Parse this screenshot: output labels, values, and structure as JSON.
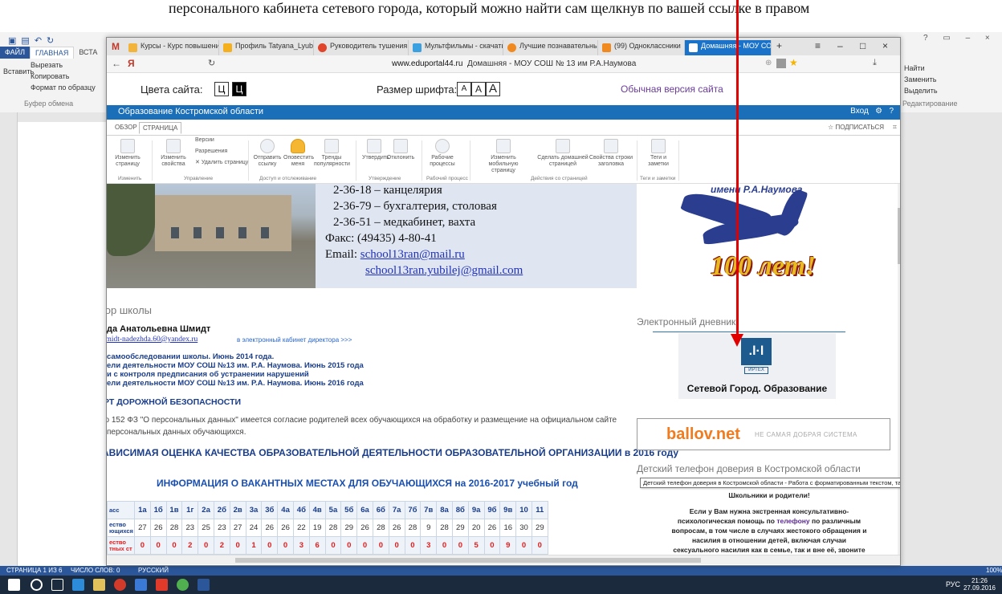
{
  "doc_caption": "персонального кабинета сетевого города, который можно найти сам щелкнув по вашей ссылке в правом",
  "word": {
    "tabs": [
      "ФАЙЛ",
      "ГЛАВНАЯ",
      "ВСТА"
    ],
    "clipboard": {
      "cut": "Вырезать",
      "copy": "Копировать",
      "paste": "Вставить",
      "format": "Формат по образцу",
      "group": "Буфер обмена"
    },
    "editing": {
      "find": "Найти",
      "replace": "Заменить",
      "select": "Выделить",
      "group": "Редактирование"
    },
    "status": {
      "page": "СТРАНИЦА 1 ИЗ 6",
      "words": "ЧИСЛО СЛОВ: 0",
      "lang": "РУССКИЙ",
      "zoom": "100%"
    }
  },
  "taskbar": {
    "lang": "РУС",
    "time": "21:26",
    "date": "27.09.2016"
  },
  "browser": {
    "tabs": [
      {
        "label": "Курсы - Курс повышени",
        "color": "#f2b43a"
      },
      {
        "label": "Профиль Tatyana_Lyubi",
        "color": "#f5b020"
      },
      {
        "label": "Руководитель тушения",
        "color": "#e0442a"
      },
      {
        "label": "Мультфильмы - скачать",
        "color": "#3aa0e0"
      },
      {
        "label": "Лучшие познавательны",
        "color": "#f08a20"
      },
      {
        "label": "(99) Одноклассники",
        "color": "#f08a20"
      },
      {
        "label": "Домашняя - МОУ СО",
        "color": "#ffffff"
      }
    ],
    "address_domain": "www.eduportal44.ru",
    "address_title": "Домашняя - МОУ СОШ № 13 им Р.А.Наумова"
  },
  "accessibility": {
    "colors_label": "Цвета сайта:",
    "color_btn": "Ц",
    "font_label": "Размер шрифта:",
    "font_btn": "A",
    "normal_link": "Обычная версия сайта"
  },
  "sp": {
    "site_title": "Образование Костромской области",
    "login": "Вход",
    "tabs": [
      "ОБЗОР",
      "СТРАНИЦА"
    ],
    "subscribe": "ПОДПИСАТЬСЯ",
    "ribbon": [
      {
        "label": "Изменить страницу"
      },
      {
        "label": "Изменить свойства"
      },
      {
        "label": "Версии"
      },
      {
        "label": "Разрешения"
      },
      {
        "label": "Удалить страницу"
      },
      {
        "label": "Отправить ссылку"
      },
      {
        "label": "Оповестить меня"
      },
      {
        "label": "Тренды популярности"
      },
      {
        "label": "Утвердить"
      },
      {
        "label": "Отклонить"
      },
      {
        "label": "Рабочие процессы"
      },
      {
        "label": "Изменить мобильную страницу"
      },
      {
        "label": "Сделать домашней страницей"
      },
      {
        "label": "Свойства строки заголовка"
      },
      {
        "label": "Теги и заметки"
      }
    ],
    "groups": [
      "Изменить",
      "Управление",
      "Доступ и отслеживание",
      "Утверждение",
      "Рабочий процесс",
      "Действия со страницей",
      "Теги и заметки"
    ]
  },
  "contacts": {
    "line1": "2-36-18 – канцелярия",
    "line2": "2-36-79 – бухгалтерия, столовая",
    "line3": "2-36-51 – медкабинет, вахта",
    "fax": "Факс: (49435) 4-80-41",
    "email_label": "Email:",
    "email1": "school13ran@mail.ru",
    "email2": "school13ran.yubilej@gmail.com"
  },
  "logo": {
    "name": "имени Р.А.Наумова",
    "years": "100 лет!"
  },
  "left": {
    "director_heading": "тор школы",
    "director_name": "да Анатольевна Шмидт",
    "director_email": "shmidt-nadezhda.60@yandex.ru",
    "director_cabinet": "в электронный кабинет директора >>>",
    "reports": [
      "самообследовании школы. Июнь 2014 года.",
      "ели деятельности МОУ СОШ №13 им. Р.А. Наумова. Июнь 2015 года",
      "и с контроля предписания об устранении нарушений",
      "ели деятельности МОУ СОШ №13 им. Р.А. Наумова. Июнь 2016 года"
    ],
    "road_safety": "РТ ДОРОЖНОЙ БЕЗОПАСНОСТИ",
    "privacy_1": "но 152 ФЗ \"О персональных данных\" имеется согласие родителей всех обучающихся на обработку и размещение на официальном сайте",
    "privacy_2": "персональных данных обучающихся.",
    "quality_title": "АВИСИМАЯ ОЦЕНКА КАЧЕСТВА ОБРАЗОВАТЕЛЬНОЙ ДЕЯТЕЛЬНОСТИ ОБРАЗОВАТЕЛЬНОЙ ОРГАНИЗАЦИИ в 2016 году",
    "vacancy_title": "ИНФОРМАЦИЯ О ВАКАНТНЫХ МЕСТАХ ДЛЯ ОБУЧАЮЩИХСЯ на 2016-2017 учебный год"
  },
  "vacancy_table": {
    "row_labels": [
      "асс",
      "ество ющихся",
      "ество тных ст"
    ],
    "classes": [
      "1а",
      "1б",
      "1в",
      "1г",
      "2а",
      "2б",
      "2в",
      "3а",
      "3б",
      "4а",
      "4б",
      "4в",
      "5а",
      "5б",
      "6а",
      "6б",
      "7а",
      "7б",
      "7в",
      "8а",
      "8б",
      "9а",
      "9б",
      "9в",
      "10",
      "11"
    ],
    "students": [
      "27",
      "26",
      "28",
      "23",
      "25",
      "23",
      "27",
      "24",
      "26",
      "26",
      "22",
      "19",
      "28",
      "29",
      "26",
      "28",
      "26",
      "28",
      "9",
      "28",
      "29",
      "20",
      "26",
      "16",
      "30",
      "29"
    ],
    "vacancies": [
      "0",
      "0",
      "0",
      "2",
      "0",
      "2",
      "0",
      "1",
      "0",
      "0",
      "3",
      "6",
      "0",
      "0",
      "0",
      "0",
      "0",
      "0",
      "3",
      "0",
      "0",
      "5",
      "0",
      "9",
      "0",
      "0"
    ]
  },
  "right": {
    "diary_title": "Электронный дневник",
    "netgorod_brand": "ИРТЕХ",
    "netgorod_label": "Сетевой Город. Образование",
    "ballov_brand": "ballov.net",
    "ballov_slogan": "НЕ САМАЯ ДОБРАЯ СИСТЕМА",
    "phone_title": "Детский телефон доверия в Костромской области",
    "tooltip": "Детский телефон доверия в Костромской области - Работа с форматированным текстом, таблицами и рисунками.",
    "help_heading": "Школьники и родители!",
    "help_1": "Если у Вам нужна экстренная консультативно-психологическая помощь по",
    "help_phone": "телефону",
    "help_2": "по различным вопросам, в том числе в случаях жестокого обращения и насилия в отношении детей, включая случаи сексуального насилия как в семье, так и вне её, звоните по указанному"
  }
}
